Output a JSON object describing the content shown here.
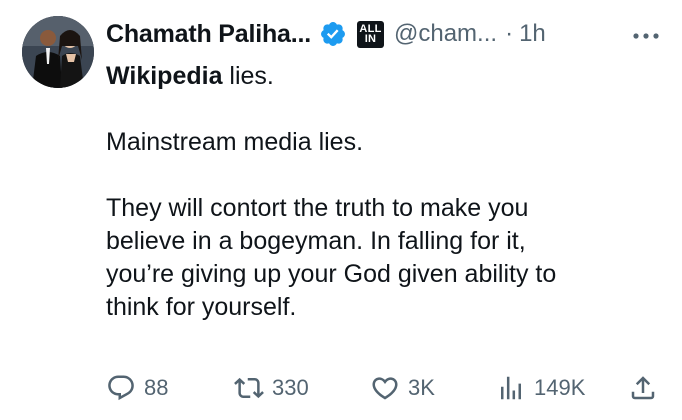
{
  "author": {
    "name": "Chamath Paliha...",
    "handle": "@cham...",
    "separator": "·",
    "time": "1h",
    "affiliate_badge": [
      "ALL",
      "IN"
    ],
    "verified_icon": "verified-badge-icon",
    "verified_color": "#1d9bf0"
  },
  "post": {
    "line1_bold": "Wikipedia",
    "line1_rest": " lies.",
    "para2": "Mainstream media lies.",
    "para3_lines": [
      "They will contort the truth to make you",
      "believe in a bogeyman. In falling for it,",
      "you’re giving up your God given ability to",
      "think for yourself."
    ]
  },
  "actions": {
    "replies": "88",
    "reposts": "330",
    "likes": "3K",
    "views": "149K"
  },
  "colors": {
    "text": "#0f1419",
    "muted": "#536471"
  }
}
